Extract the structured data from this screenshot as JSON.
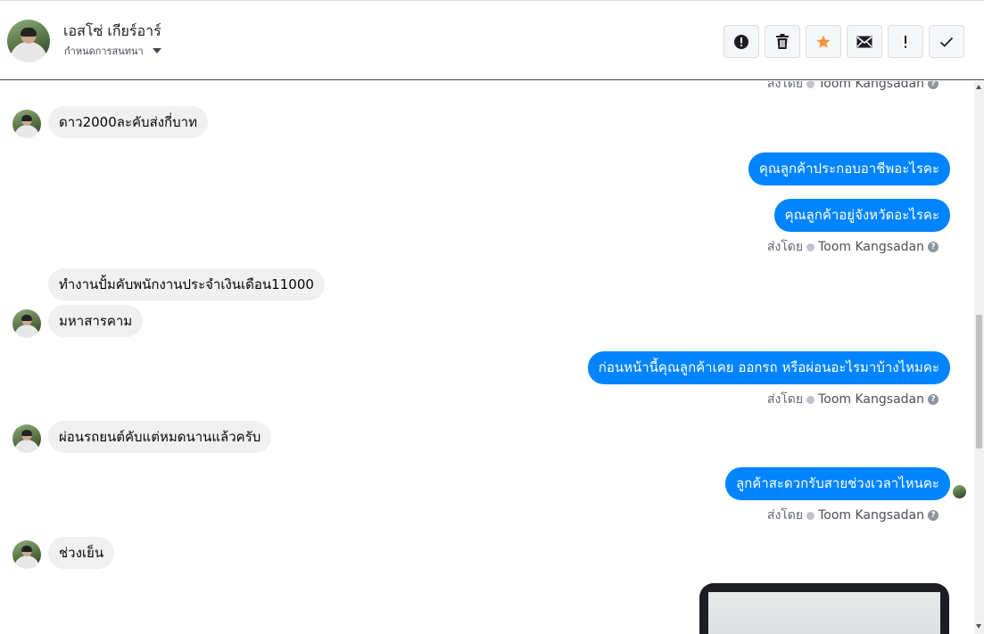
{
  "header": {
    "contact_name": "เอสโซ่ เกียร์อาร์",
    "contact_sub": "กำหนดการสนทนา",
    "toolbar": [
      "alert-circle-icon",
      "trash-icon",
      "star-icon",
      "mail-icon",
      "exclamation-icon",
      "check-icon"
    ],
    "colors": {
      "star": "#f7923b",
      "accent": "#0084ff"
    }
  },
  "sent_by": {
    "prefix": "ส่งโดย",
    "agent": "Toom Kangsadan",
    "help": "?"
  },
  "messages": [
    {
      "side": "in",
      "text": "ดาว2000ละคับส่งกี่บาท"
    },
    {
      "side": "out",
      "text": "คุณลูกค้าประกอบอาชีพอะไรคะ"
    },
    {
      "side": "out",
      "text": "คุณลูกค้าอยู่จังหวัดอะไรคะ"
    },
    {
      "side": "in",
      "text": "ทำงานปั้มคับพนักงานประจำเงินเดือน11000"
    },
    {
      "side": "in",
      "text": "มหาสารคาม"
    },
    {
      "side": "out",
      "text": "ก่อนหน้านี้คุณลูกค้าเคย ออกรถ หรือผ่อนอะไรมาบ้างไหมคะ"
    },
    {
      "side": "in",
      "text": "ผ่อนรถยนต์คับแต่หมดนานแล้วครับ"
    },
    {
      "side": "out",
      "text": "ลูกค้าสะดวกรับสายช่วงเวลาไหนคะ"
    },
    {
      "side": "in",
      "text": "ช่วงเย็น"
    }
  ]
}
